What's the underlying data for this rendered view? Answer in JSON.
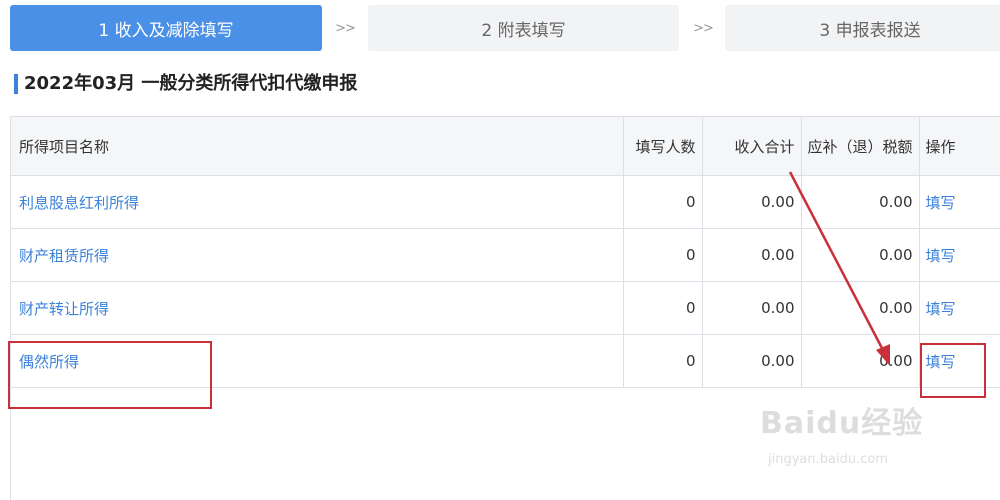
{
  "steps": [
    {
      "label": "1 收入及减除填写",
      "active": true
    },
    {
      "label": "2 附表填写",
      "active": false
    },
    {
      "label": "3 申报表报送",
      "active": false
    }
  ],
  "step_separator": ">>",
  "page_title": "2022年03月  一般分类所得代扣代缴申报",
  "table": {
    "headers": {
      "name": "所得项目名称",
      "count": "填写人数",
      "income": "收入合计",
      "tax": "应补（退）税额",
      "op": "操作"
    },
    "rows": [
      {
        "name": "利息股息红利所得",
        "count": "0",
        "income": "0.00",
        "tax": "0.00",
        "op": "填写"
      },
      {
        "name": "财产租赁所得",
        "count": "0",
        "income": "0.00",
        "tax": "0.00",
        "op": "填写"
      },
      {
        "name": "财产转让所得",
        "count": "0",
        "income": "0.00",
        "tax": "0.00",
        "op": "填写"
      },
      {
        "name": "偶然所得",
        "count": "0",
        "income": "0.00",
        "tax": "0.00",
        "op": "填写"
      }
    ]
  },
  "watermark": {
    "logo": "Baidu经验",
    "url": "jingyan.baidu.com"
  },
  "colors": {
    "accent": "#4a90e6",
    "link": "#3b82d9",
    "annotation": "#c9303a"
  }
}
